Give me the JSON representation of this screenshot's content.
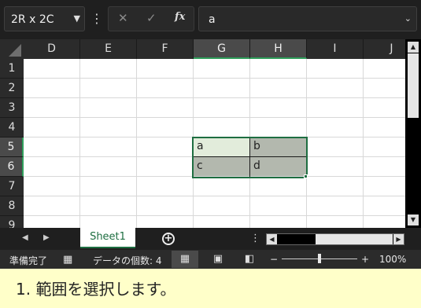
{
  "formula_bar": {
    "name_box": "2R x 2C",
    "formula_value": "a",
    "cancel_icon": "✕",
    "enter_icon": "✓",
    "function_icon": "fx"
  },
  "columns": [
    "D",
    "E",
    "F",
    "G",
    "H",
    "I",
    "J"
  ],
  "rows": [
    "1",
    "2",
    "3",
    "4",
    "5",
    "6",
    "7",
    "8",
    "9"
  ],
  "cells": {
    "G5": "a",
    "H5": "b",
    "G6": "c",
    "H6": "d"
  },
  "selection": {
    "range": [
      "G5",
      "H6"
    ],
    "active_cell": "G5",
    "colors": {
      "active_fill": "#e2ecdb",
      "range_fill": "#b3b8ae",
      "border": "#1e6e41"
    }
  },
  "sheet_tabs": {
    "tabs": [
      "Sheet1"
    ],
    "active": "Sheet1"
  },
  "status_bar": {
    "ready": "準備完了",
    "count": "データの個数: 4",
    "zoom_minus": "−",
    "zoom_plus": "+",
    "zoom": "100%"
  },
  "caption": "1.  範囲を選択します。"
}
